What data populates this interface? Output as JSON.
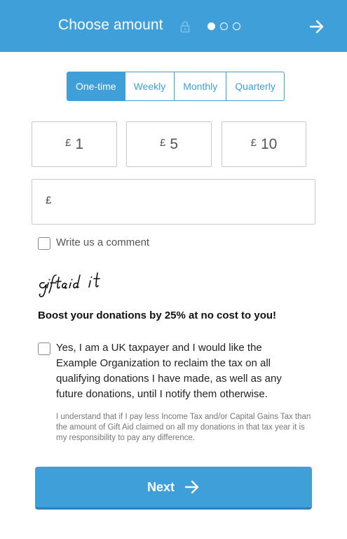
{
  "header": {
    "title": "Choose amount",
    "steps": 3,
    "current_step": 1
  },
  "frequency": {
    "tabs": [
      "One-time",
      "Weekly",
      "Monthly",
      "Quarterly"
    ],
    "selected": "One-time"
  },
  "amounts": [
    {
      "currency": "£",
      "value": "1"
    },
    {
      "currency": "£",
      "value": "5"
    },
    {
      "currency": "£",
      "value": "10"
    }
  ],
  "custom_amount": {
    "currency": "£",
    "value": "",
    "placeholder": ""
  },
  "comment": {
    "label": "Write us a comment",
    "checked": false
  },
  "giftaid": {
    "logo_text": "giftaid it",
    "boost_text": "Boost your donations by 25% at no cost to you!",
    "declaration": "Yes, I am a UK taxpayer and I would like the Example Organization to reclaim the tax on all qualifying donations I have made, as well as any future donations, until I notify them otherwise.",
    "small_print": "I understand that if I pay less Income Tax and/or Capital Gains Tax than the amount of Gift Aid claimed on all my donations in that tax year it is my responsibility to pay any difference.",
    "checked": false
  },
  "next_button": {
    "label": "Next"
  },
  "colors": {
    "accent": "#3f9fd9",
    "border": "#c9c9c9"
  },
  "icons": {
    "header_lock": "lock-icon",
    "header_next": "arrow-right-icon",
    "button_next": "arrow-right-icon"
  }
}
